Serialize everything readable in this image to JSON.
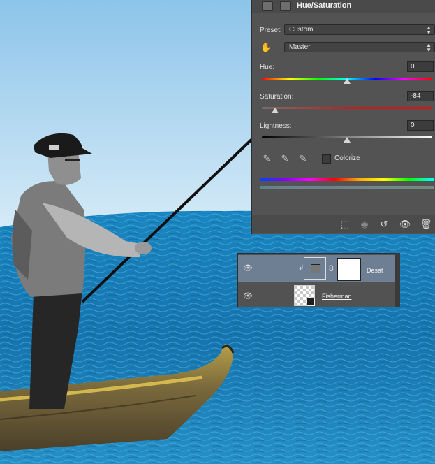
{
  "hue_saturation": {
    "title": "Hue/Saturation",
    "preset_label": "Preset:",
    "preset_value": "Custom",
    "channel_value": "Master",
    "hue_label": "Hue:",
    "hue_value": "0",
    "saturation_label": "Saturation:",
    "saturation_value": "-84",
    "lightness_label": "Lightness:",
    "lightness_value": "0",
    "colorize_label": "Colorize"
  },
  "layers": [
    {
      "name": "Desat",
      "type": "adjustment",
      "selected": true,
      "visible": true
    },
    {
      "name": "Fisherman",
      "type": "smart-object",
      "selected": false,
      "visible": true
    }
  ],
  "icons": {
    "eye": "eye-icon",
    "eyedropper": "eyedropper-icon",
    "trash": "trash-icon",
    "reset": "reset-icon",
    "clip": "clip-to-layer-icon",
    "hand": "targeted-adjustment-icon"
  },
  "colors": {
    "panel_bg": "#535353",
    "layer_selected": "#6e7f94",
    "sea": "#1a7fb9",
    "sky": "#bcdcf2"
  }
}
